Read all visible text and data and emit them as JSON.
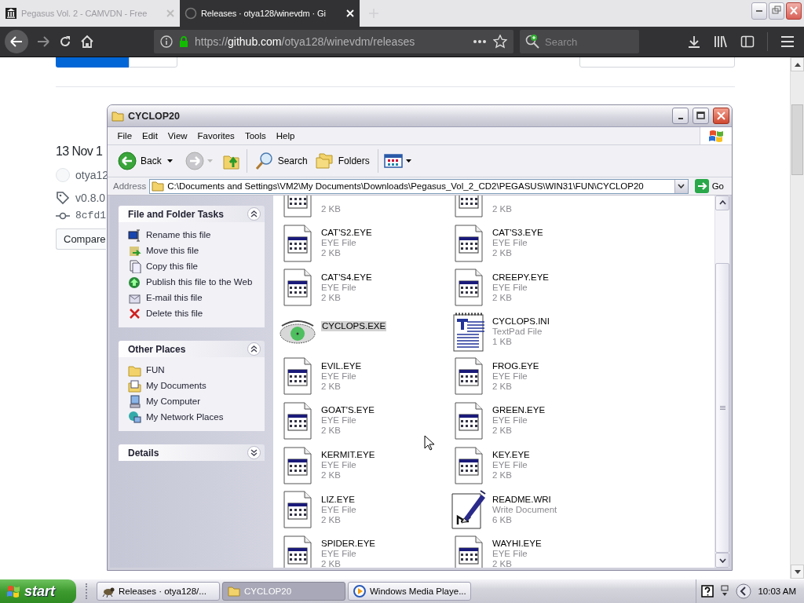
{
  "browser": {
    "tabs": [
      {
        "label": "Pegasus Vol. 2 - CAMVDN - Free",
        "selected": false
      },
      {
        "label": "Releases · otya128/winevdm · Gi",
        "selected": true
      }
    ],
    "url": "https://**github.com**/otya128/winevdm/releases",
    "search": {
      "placeholder": "Search"
    }
  },
  "page": {
    "release_date": "13 Nov 1",
    "author": "otya12",
    "tag": "v0.8.0",
    "commit": "8cfd1",
    "compare_button": "Compare"
  },
  "explorer": {
    "title": "CYCLOP20",
    "menus": [
      "File",
      "Edit",
      "View",
      "Favorites",
      "Tools",
      "Help"
    ],
    "toolbar": {
      "back": "Back",
      "search": "Search",
      "folders": "Folders"
    },
    "address": {
      "label": "Address",
      "path": "C:\\Documents and Settings\\VM2\\My Documents\\Downloads\\Pegasus_Vol_2_CD2\\PEGASUS\\WIN31\\FUN\\CYCLOP20",
      "go": "Go"
    },
    "panels": [
      {
        "title": "File and Folder Tasks",
        "expanded": true,
        "items": [
          {
            "label": "Rename this file",
            "kind": "rename"
          },
          {
            "label": "Move this file",
            "kind": "move"
          },
          {
            "label": "Copy this file",
            "kind": "copy"
          },
          {
            "label": "Publish this file to the Web",
            "kind": "web"
          },
          {
            "label": "E-mail this file",
            "kind": "mail"
          },
          {
            "label": "Delete this file",
            "kind": "delete"
          }
        ]
      },
      {
        "title": "Other Places",
        "expanded": true,
        "items": [
          {
            "label": "FUN",
            "kind": "folder"
          },
          {
            "label": "My Documents",
            "kind": "documents"
          },
          {
            "label": "My Computer",
            "kind": "computer"
          },
          {
            "label": "My Network Places",
            "kind": "network"
          }
        ]
      },
      {
        "title": "Details",
        "expanded": false
      }
    ],
    "files": [
      {
        "size": "2 KB",
        "kind": "eye"
      },
      {
        "size": "2 KB",
        "kind": "eye"
      },
      {
        "name": "CAT'S2.EYE",
        "type": "EYE File",
        "size": "2 KB",
        "kind": "eye",
        "selected": false
      },
      {
        "name": "CAT'S3.EYE",
        "type": "EYE File",
        "size": "2 KB",
        "kind": "eye",
        "selected": false
      },
      {
        "name": "CAT'S4.EYE",
        "type": "EYE File",
        "size": "2 KB",
        "kind": "eye",
        "selected": false
      },
      {
        "name": "CREEPY.EYE",
        "type": "EYE File",
        "size": "2 KB",
        "kind": "eye",
        "selected": false
      },
      {
        "name": "CYCLOPS.EXE",
        "kind": "exe",
        "selected": true
      },
      {
        "name": "CYCLOPS.INI",
        "type": "TextPad File",
        "size": "1 KB",
        "kind": "textpad",
        "selected": false
      },
      {
        "name": "EVIL.EYE",
        "type": "EYE File",
        "size": "2 KB",
        "kind": "eye",
        "selected": false
      },
      {
        "name": "FROG.EYE",
        "type": "EYE File",
        "size": "2 KB",
        "kind": "eye",
        "selected": false
      },
      {
        "name": "GOAT'S.EYE",
        "type": "EYE File",
        "size": "2 KB",
        "kind": "eye",
        "selected": false
      },
      {
        "name": "GREEN.EYE",
        "type": "EYE File",
        "size": "2 KB",
        "kind": "eye",
        "selected": false
      },
      {
        "name": "KERMIT.EYE",
        "type": "EYE File",
        "size": "2 KB",
        "kind": "eye",
        "selected": false
      },
      {
        "name": "KEY.EYE",
        "type": "EYE File",
        "size": "2 KB",
        "kind": "eye",
        "selected": false
      },
      {
        "name": "LIZ.EYE",
        "type": "EYE File",
        "size": "2 KB",
        "kind": "eye",
        "selected": false
      },
      {
        "name": "README.WRI",
        "type": "Write Document",
        "size": "6 KB",
        "kind": "write",
        "selected": false
      },
      {
        "name": "SPIDER.EYE",
        "type": "EYE File",
        "size": "2 KB",
        "kind": "eye",
        "selected": false
      },
      {
        "name": "WAYHI.EYE",
        "type": "EYE File",
        "size": "2 KB",
        "kind": "eye",
        "selected": false
      }
    ]
  },
  "taskbar": {
    "start": "start",
    "tasks": [
      {
        "label": "Releases · otya128/...",
        "kind": "browser",
        "selected": false
      },
      {
        "label": "CYCLOP20",
        "kind": "folder",
        "selected": true
      },
      {
        "label": "Windows Media Playe...",
        "kind": "media",
        "selected": false
      }
    ],
    "clock": "10:03 AM"
  }
}
